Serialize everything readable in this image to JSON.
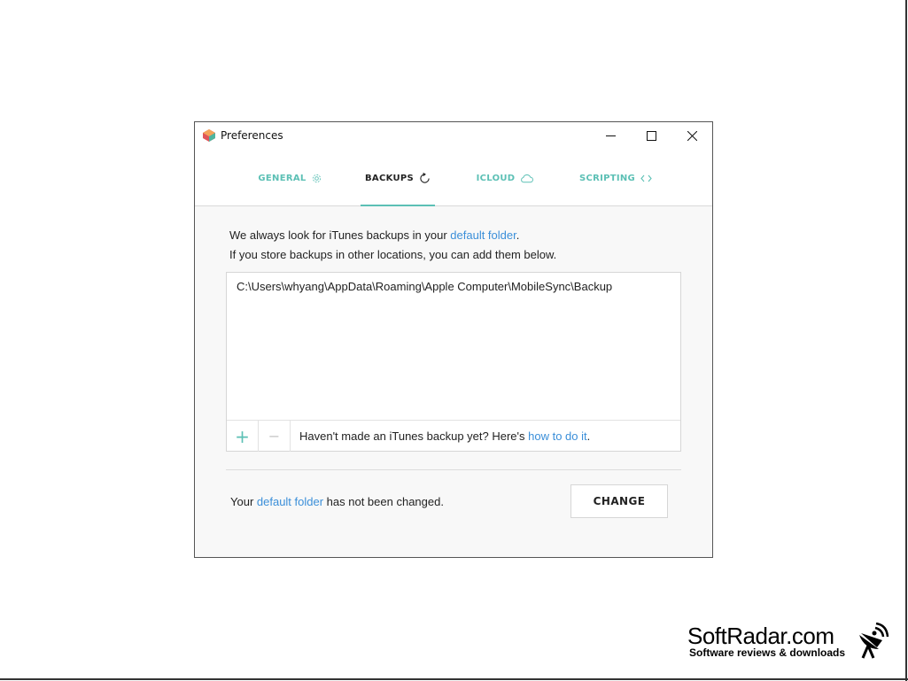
{
  "window": {
    "title": "Preferences",
    "controls": {
      "minimize": "—",
      "maximize": "☐",
      "close": "✕"
    }
  },
  "tabs": [
    {
      "label": "GENERAL",
      "icon": "gear-icon",
      "active": false
    },
    {
      "label": "BACKUPS",
      "icon": "refresh-icon",
      "active": true
    },
    {
      "label": "ICLOUD",
      "icon": "cloud-icon",
      "active": false
    },
    {
      "label": "SCRIPTING",
      "icon": "code-icon",
      "active": false
    }
  ],
  "intro": {
    "line1_prefix": "We always look for iTunes backups in your ",
    "line1_link": "default folder",
    "line1_suffix": ".",
    "line2": "If you store backups in other locations, you can add them below."
  },
  "locations": {
    "items": [
      "C:\\Users\\whyang\\AppData\\Roaming\\Apple Computer\\MobileSync\\Backup"
    ],
    "add_label": "+",
    "remove_label": "−",
    "hint_prefix": "Haven't made an iTunes backup yet? Here's ",
    "hint_link": "how to do it",
    "hint_suffix": "."
  },
  "status": {
    "prefix": "Your ",
    "link": "default folder",
    "suffix": " has not been changed.",
    "button_label": "CHANGE"
  },
  "watermark": {
    "name": "SoftRadar.com",
    "tagline": "Software reviews & downloads"
  },
  "colors": {
    "accent": "#5cc0b5",
    "link": "#3b8fd9",
    "window_bg": "#f8f8f8"
  }
}
